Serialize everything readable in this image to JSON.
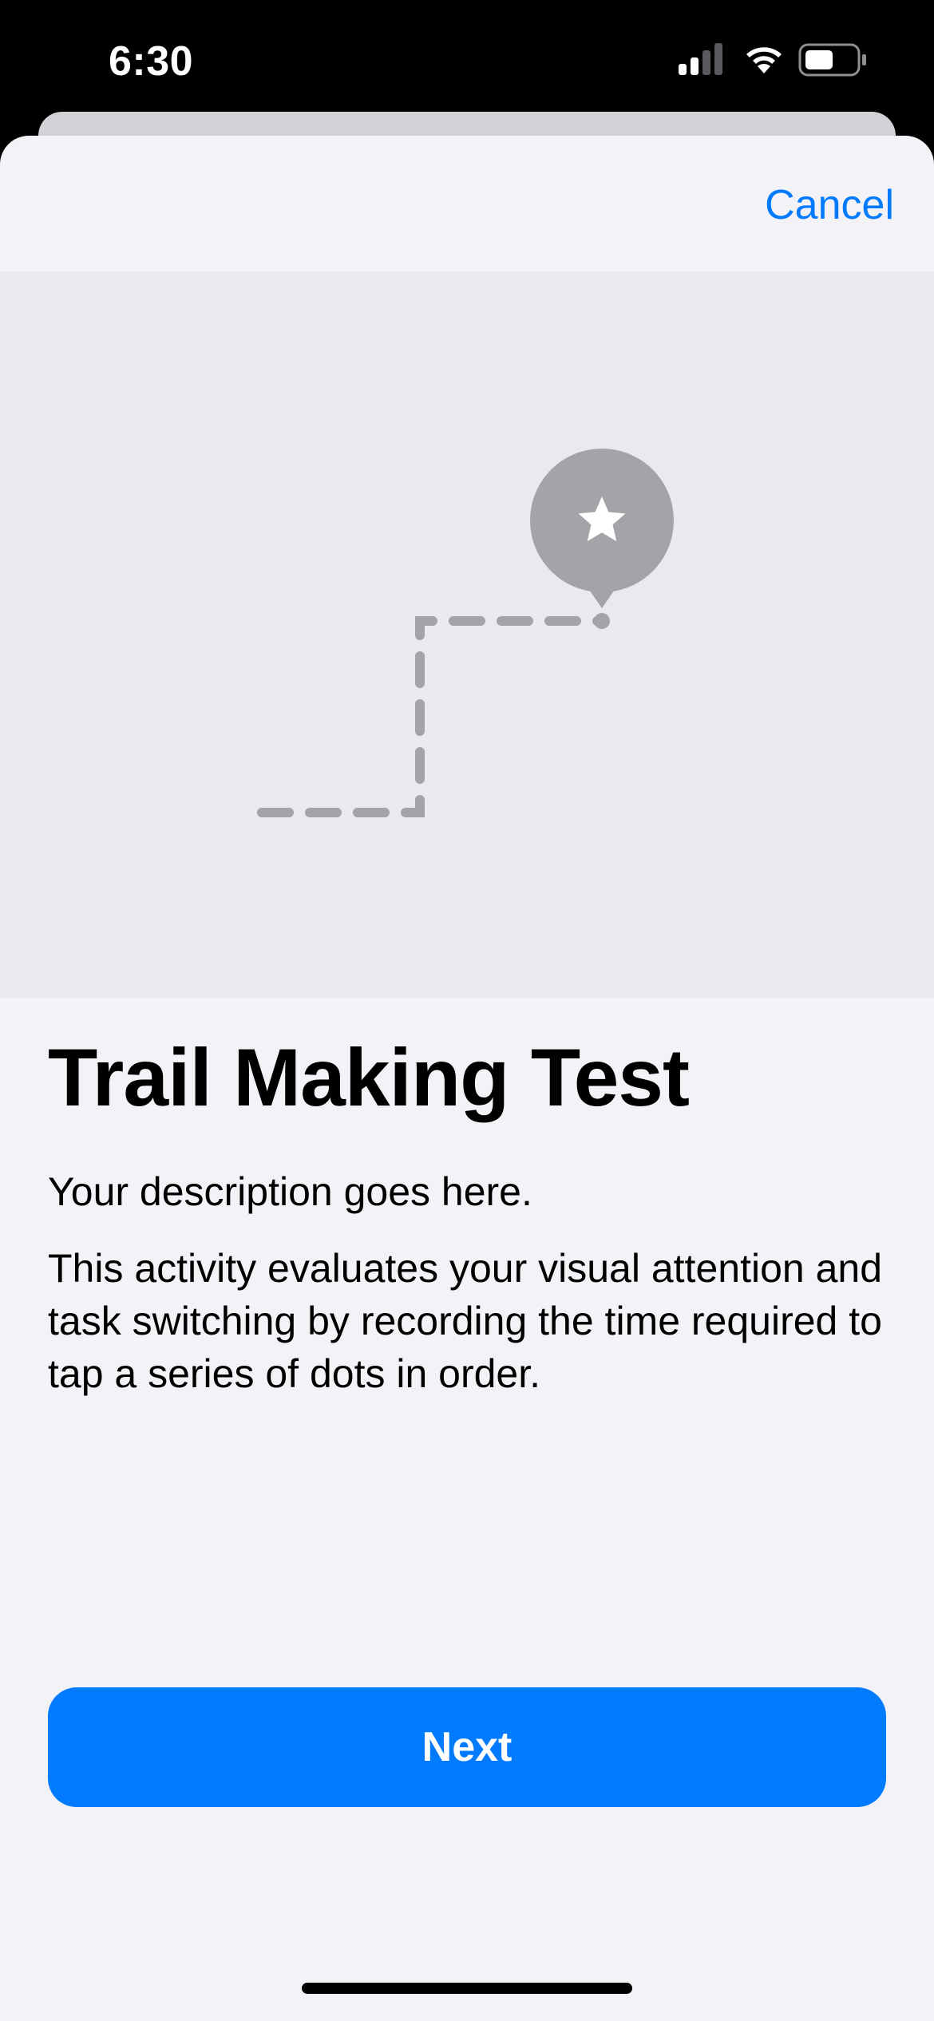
{
  "status_bar": {
    "time": "6:30",
    "icons": [
      "cellular-signal-icon",
      "wifi-icon",
      "battery-icon"
    ]
  },
  "nav": {
    "cancel_label": "Cancel"
  },
  "illustration": {
    "icon": "star-pin-icon",
    "path_style": "dashed-trail"
  },
  "main": {
    "title": "Trail Making Test",
    "description": "Your description goes here.",
    "details": "This activity evaluates your visual attention and task switching by recording the time required to tap a series of dots in order."
  },
  "footer": {
    "next_label": "Next"
  },
  "colors": {
    "accent": "#007aff",
    "sheet_background": "#f2f2f7",
    "illustration_background": "#e9e9ee",
    "illustration_gray": "#a3a3a8"
  }
}
